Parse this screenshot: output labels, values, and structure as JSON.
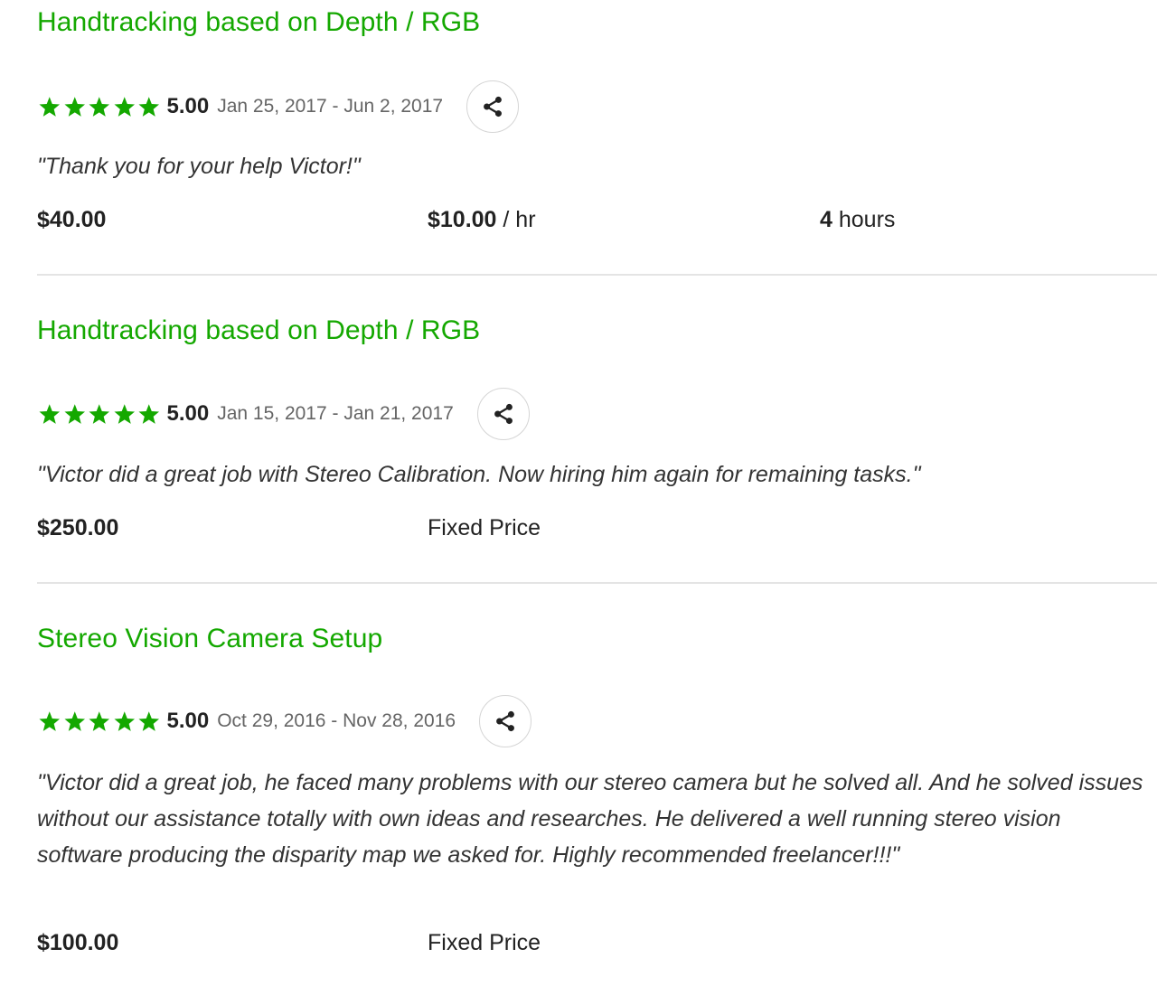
{
  "colors": {
    "accent": "#14a800",
    "title": "#14a800",
    "star": "#14a800"
  },
  "jobs": [
    {
      "title": "Handtracking based on Depth / RGB",
      "rating": 5,
      "score": "5.00",
      "dates": "Jan 25, 2017 - Jun 2, 2017",
      "share_icon": "share-icon",
      "feedback": "\"Thank you for your help Victor!\"",
      "earned": "$40.00",
      "rate": "$10.00",
      "rate_unit": " / hr",
      "hours": "4",
      "hours_unit": " hours"
    },
    {
      "title": "Handtracking based on Depth / RGB",
      "rating": 5,
      "score": "5.00",
      "dates": "Jan 15, 2017 - Jan 21, 2017",
      "share_icon": "share-icon",
      "feedback": "\"Victor did a great job with Stereo Calibration. Now hiring him again for remaining tasks.\"",
      "earned": "$250.00",
      "price_type": "Fixed Price"
    },
    {
      "title": "Stereo Vision Camera Setup",
      "rating": 5,
      "score": "5.00",
      "dates": "Oct 29, 2016 - Nov 28, 2016",
      "share_icon": "share-icon",
      "feedback": "\"Victor did a great job, he faced many problems with our stereo camera but he solved all. And he solved issues without our assistance totally with own ideas and researches. He delivered a well running stereo vision software producing the disparity map we asked for. Highly recommended freelancer!!!\"",
      "earned": "$100.00",
      "price_type": "Fixed Price"
    }
  ]
}
